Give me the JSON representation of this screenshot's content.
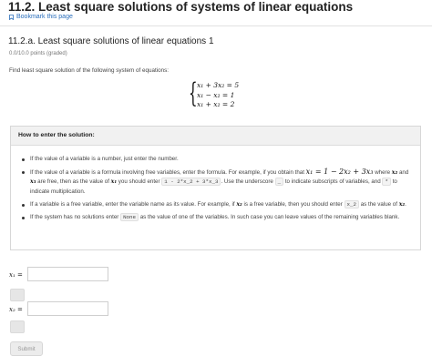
{
  "header": {
    "title": "11.2. Least square solutions of systems of linear equations",
    "bookmark_label": "Bookmark this page"
  },
  "problem": {
    "title": "11.2.a. Least square solutions of linear equations 1",
    "points": "0.0/10.0 points (graded)",
    "prompt": "Find least square solution of the following system of equations:",
    "equations": [
      "x₁ + 3x₂ = 5",
      "x₁ − x₂ = 1",
      "x₁ + x₂ = 2"
    ]
  },
  "instructions": {
    "heading": "How to enter the solution:",
    "b1": "If the value of a variable is a number, just enter the number.",
    "b2_a": "If the value of a variable is a formula involving free variables, enter the formula. For example, if you obtain that",
    "b2_eq": "x₁ = 1 − 2x₂ + 3x₃",
    "b2_b": "where",
    "b2_x2": "x₂",
    "b2_c": "and",
    "b2_x3": "x₃",
    "b2_d": "are free, then as the value of",
    "b2_x1": "x₁",
    "b2_e": "you should enter",
    "b2_code1": "1 - 2*x_2 + 3*x_3",
    "b2_f": ". Use the underscore",
    "b2_code2": "_",
    "b2_g": "to indicate subscripts of variables, and",
    "b2_code3": "*",
    "b2_h": "to indicate multiplication.",
    "b3_a": "If a variable is a free variable, enter the variable name as its value. For example, if",
    "b3_x2": "x₂",
    "b3_b": "is a free variable, then you should enter",
    "b3_code": "x_2",
    "b3_c": "as the value of",
    "b3_x2b": "x₂",
    "b3_d": ".",
    "b4_a": "If the system has no solutions enter",
    "b4_code": "None",
    "b4_b": "as the value of one of the variables. In such case you can leave values of the remaining variables blank."
  },
  "answers": {
    "x1_label": "x₁ =",
    "x1_value": "",
    "x2_label": "x₂ =",
    "x2_value": ""
  },
  "actions": {
    "submit_label": "Submit"
  },
  "icons": {
    "bookmark": "bookmark-icon"
  },
  "colors": {
    "link": "#2a6ebb",
    "box_header": "#f1f1f1"
  }
}
